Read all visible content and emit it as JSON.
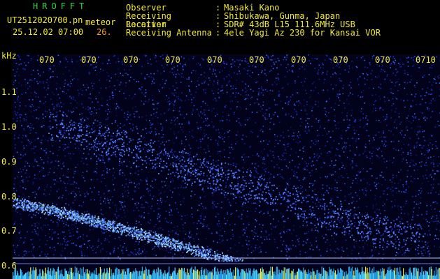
{
  "header": {
    "app_title": "HROFFT",
    "filename": "UT2512020700.pn",
    "mode": "meteor",
    "datetime": "25.12.02 07:00",
    "count": "26."
  },
  "station": [
    {
      "key": "Observer",
      "value": "Masaki Kano"
    },
    {
      "key": "Receiving Location",
      "value": "Shibukawa, Gunma, Japan"
    },
    {
      "key": "Receiver",
      "value": "SDR# 43dB L15 111.6MHz USB"
    },
    {
      "key": "Receiving Antenna",
      "value": "4ele Yagi Az 230 for Kansai VOR"
    }
  ],
  "axis": {
    "y_unit": "kHz",
    "y_ticks": [
      "1.1",
      "1.0",
      "0.9",
      "0.8",
      "0.7",
      "0.6"
    ],
    "x_ticks": [
      "070",
      "070",
      "070",
      "070",
      "070",
      "070",
      "070",
      "070",
      "070",
      "0710"
    ]
  },
  "colors": {
    "background": "#000000",
    "label": "#f2ea37",
    "title": "#34d24a",
    "count": "#f39a2d",
    "signal_low": "#1a2bb8",
    "signal_high": "#9fd6ff",
    "grid_line": "#b8c4ff"
  }
}
